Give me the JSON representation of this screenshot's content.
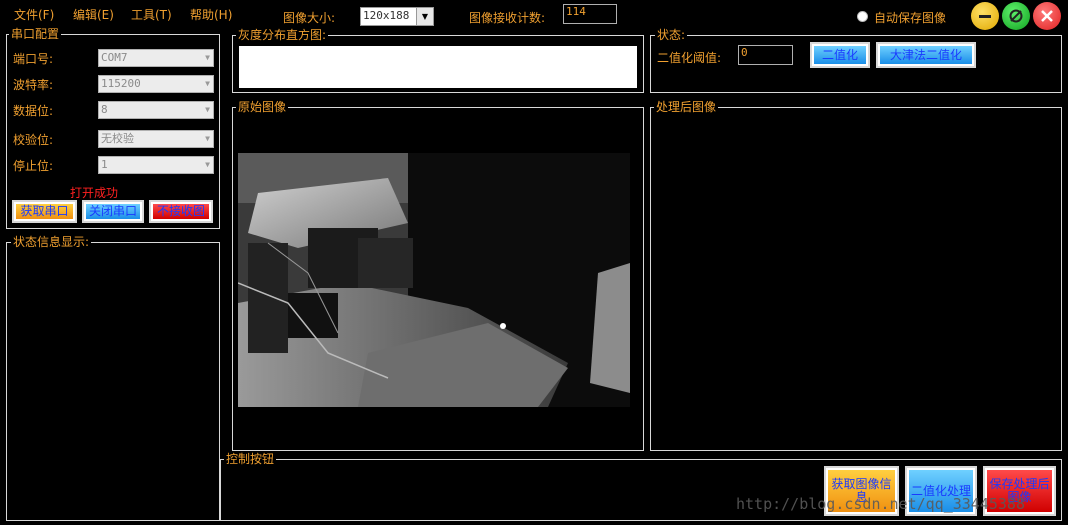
{
  "menu": {
    "file": "文件(F)",
    "edit": "编辑(E)",
    "tools": "工具(T)",
    "help": "帮助(H)"
  },
  "toolbar": {
    "image_size_label": "图像大小:",
    "image_size_value": "120x188",
    "recv_count_label": "图像接收计数:",
    "recv_count_value": "114",
    "auto_save_label": "自动保存图像"
  },
  "serial": {
    "title": "串口配置",
    "port_label": "端口号:",
    "port_value": "COM7",
    "baud_label": "波特率:",
    "baud_value": "115200",
    "data_label": "数据位:",
    "data_value": "8",
    "parity_label": "校验位:",
    "parity_value": "无校验",
    "stop_label": "停止位:",
    "stop_value": "1",
    "status_text": "打开成功",
    "get_port_btn": "获取串口",
    "close_port_btn": "关闭串口",
    "no_recv_btn": "不接收图"
  },
  "status_info": {
    "title": "状态信息显示:"
  },
  "histogram": {
    "title": "灰度分布直方图:"
  },
  "state": {
    "title": "状态:",
    "threshold_label": "二值化阈值:",
    "threshold_value": "0",
    "binarize_btn": "二值化",
    "otsu_btn": "大津法二值化"
  },
  "original": {
    "title": "原始图像"
  },
  "processed": {
    "title": "处理后图像"
  },
  "controls": {
    "title": "控制按钮",
    "get_info_btn": "获取图像信息",
    "binarize_process_btn": "二值化处理",
    "save_processed_btn": "保存处理后图像"
  },
  "window_buttons": {
    "minimize": "minimize-icon",
    "maximize": "maximize-icon",
    "close": "close-icon"
  },
  "watermark": "http://blog.csdn.net/qq_33445388",
  "colors": {
    "label": "#f0a030",
    "button_text": "#1a3aff",
    "status_red": "#ff2020",
    "background": "#000000"
  }
}
